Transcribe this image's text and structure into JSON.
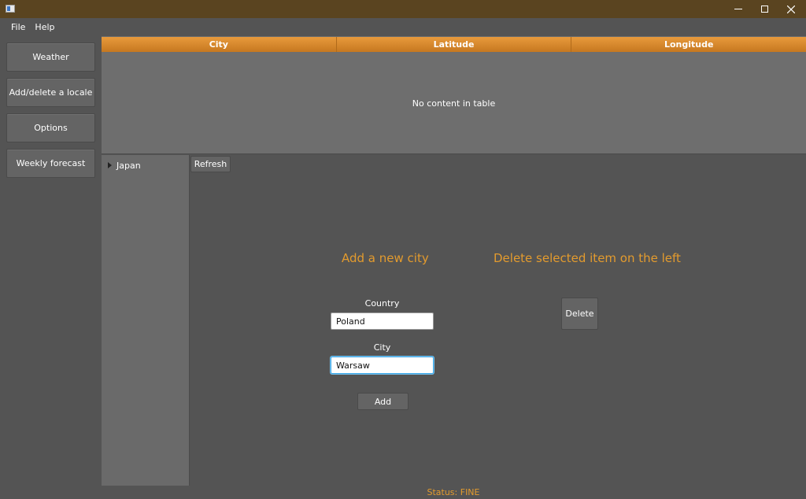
{
  "window": {
    "icon": "app-window-icon",
    "controls": {
      "minimize": "minimize-icon",
      "maximize": "maximize-icon",
      "close": "close-icon"
    }
  },
  "menu": {
    "items": [
      {
        "label": "File"
      },
      {
        "label": "Help"
      }
    ]
  },
  "sidebar": {
    "buttons": [
      {
        "label": "Weather"
      },
      {
        "label": "Add/delete a locale"
      },
      {
        "label": "Options"
      },
      {
        "label": "Weekly forecast"
      }
    ]
  },
  "table": {
    "columns": [
      "City",
      "Latitude",
      "Longitude"
    ],
    "placeholder": "No content in table",
    "header_color": "#e89a3c"
  },
  "tree": {
    "items": [
      {
        "label": "Japan",
        "expanded": false
      }
    ]
  },
  "main": {
    "refresh_label": "Refresh",
    "add_heading": "Add a new city",
    "delete_heading": "Delete selected item on the left",
    "country_label": "Country",
    "country_value": "Poland",
    "city_label": "City",
    "city_value": "Warsaw",
    "add_label": "Add",
    "delete_label": "Delete",
    "accent_color": "#e39b2e"
  },
  "status": {
    "text": "Status: FINE"
  }
}
